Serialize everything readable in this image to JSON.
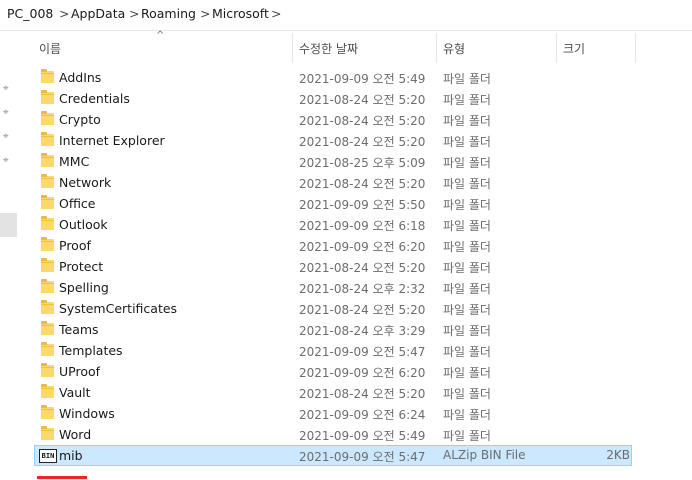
{
  "breadcrumb": [
    "PC_008",
    "AppData",
    "Roaming",
    "Microsoft"
  ],
  "breadcrumb_separator": ">",
  "columns": {
    "name": "이름",
    "date": "수정한 날짜",
    "type": "유형",
    "size": "크기"
  },
  "sort_indicator": "^",
  "pin_icon": "📌",
  "files": [
    {
      "name": "AddIns",
      "date": "2021-09-09 오전 5:49",
      "type": "파일 폴더",
      "size": "",
      "icon": "folder-icon"
    },
    {
      "name": "Credentials",
      "date": "2021-08-24 오전 5:20",
      "type": "파일 폴더",
      "size": "",
      "icon": "folder-icon"
    },
    {
      "name": "Crypto",
      "date": "2021-08-24 오전 5:20",
      "type": "파일 폴더",
      "size": "",
      "icon": "folder-icon"
    },
    {
      "name": "Internet Explorer",
      "date": "2021-08-24 오전 5:20",
      "type": "파일 폴더",
      "size": "",
      "icon": "folder-icon"
    },
    {
      "name": "MMC",
      "date": "2021-08-25 오후 5:09",
      "type": "파일 폴더",
      "size": "",
      "icon": "folder-icon"
    },
    {
      "name": "Network",
      "date": "2021-08-24 오전 5:20",
      "type": "파일 폴더",
      "size": "",
      "icon": "folder-icon"
    },
    {
      "name": "Office",
      "date": "2021-09-09 오전 5:50",
      "type": "파일 폴더",
      "size": "",
      "icon": "folder-icon"
    },
    {
      "name": "Outlook",
      "date": "2021-09-09 오전 6:18",
      "type": "파일 폴더",
      "size": "",
      "icon": "folder-icon"
    },
    {
      "name": "Proof",
      "date": "2021-09-09 오전 6:20",
      "type": "파일 폴더",
      "size": "",
      "icon": "folder-icon"
    },
    {
      "name": "Protect",
      "date": "2021-08-24 오전 5:20",
      "type": "파일 폴더",
      "size": "",
      "icon": "folder-icon"
    },
    {
      "name": "Spelling",
      "date": "2021-08-24 오후 2:32",
      "type": "파일 폴더",
      "size": "",
      "icon": "folder-icon"
    },
    {
      "name": "SystemCertificates",
      "date": "2021-08-24 오전 5:20",
      "type": "파일 폴더",
      "size": "",
      "icon": "folder-icon"
    },
    {
      "name": "Teams",
      "date": "2021-08-24 오후 3:29",
      "type": "파일 폴더",
      "size": "",
      "icon": "folder-icon"
    },
    {
      "name": "Templates",
      "date": "2021-09-09 오전 5:47",
      "type": "파일 폴더",
      "size": "",
      "icon": "folder-icon"
    },
    {
      "name": "UProof",
      "date": "2021-09-09 오전 6:20",
      "type": "파일 폴더",
      "size": "",
      "icon": "folder-icon"
    },
    {
      "name": "Vault",
      "date": "2021-08-24 오전 5:20",
      "type": "파일 폴더",
      "size": "",
      "icon": "folder-icon"
    },
    {
      "name": "Windows",
      "date": "2021-09-09 오전 6:24",
      "type": "파일 폴더",
      "size": "",
      "icon": "folder-icon"
    },
    {
      "name": "Word",
      "date": "2021-09-09 오전 5:49",
      "type": "파일 폴더",
      "size": "",
      "icon": "folder-icon"
    },
    {
      "name": "mib",
      "date": "2021-09-09 오전 5:47",
      "type": "ALZip BIN File",
      "size": "2KB",
      "icon": "bin-file-icon",
      "bin_label": "BIN",
      "selected": true
    }
  ],
  "colors": {
    "selection_bg": "#cce8ff",
    "selection_border": "#99d1ff",
    "folder": "#f8d775",
    "annotation_red": "#e8262b"
  }
}
